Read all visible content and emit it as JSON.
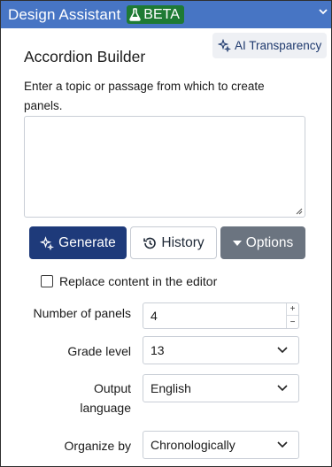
{
  "header": {
    "title": "Design Assistant",
    "badge": "BETA"
  },
  "ai_transparency": {
    "label": "AI Transparency"
  },
  "main": {
    "heading": "Accordion Builder",
    "intro": "Enter a topic or passage from which to create panels.",
    "topic_input": {
      "value": "",
      "placeholder": ""
    }
  },
  "actions": {
    "generate": "Generate",
    "history": "History",
    "options": "Options"
  },
  "replace_content": {
    "label": "Replace content in the editor",
    "checked": false
  },
  "settings": {
    "panels": {
      "label": "Number of panels",
      "value": "4"
    },
    "grade": {
      "label": "Grade level",
      "value": "13"
    },
    "language": {
      "label_line1": "Output",
      "label_line2": "language",
      "value": "English"
    },
    "organize": {
      "label": "Organize by",
      "value": "Chronologically"
    }
  },
  "colors": {
    "header_bg": "#4775c4",
    "badge_bg": "#1e7a34",
    "generate_bg": "#1e3a7a",
    "options_bg": "#6b7480"
  }
}
